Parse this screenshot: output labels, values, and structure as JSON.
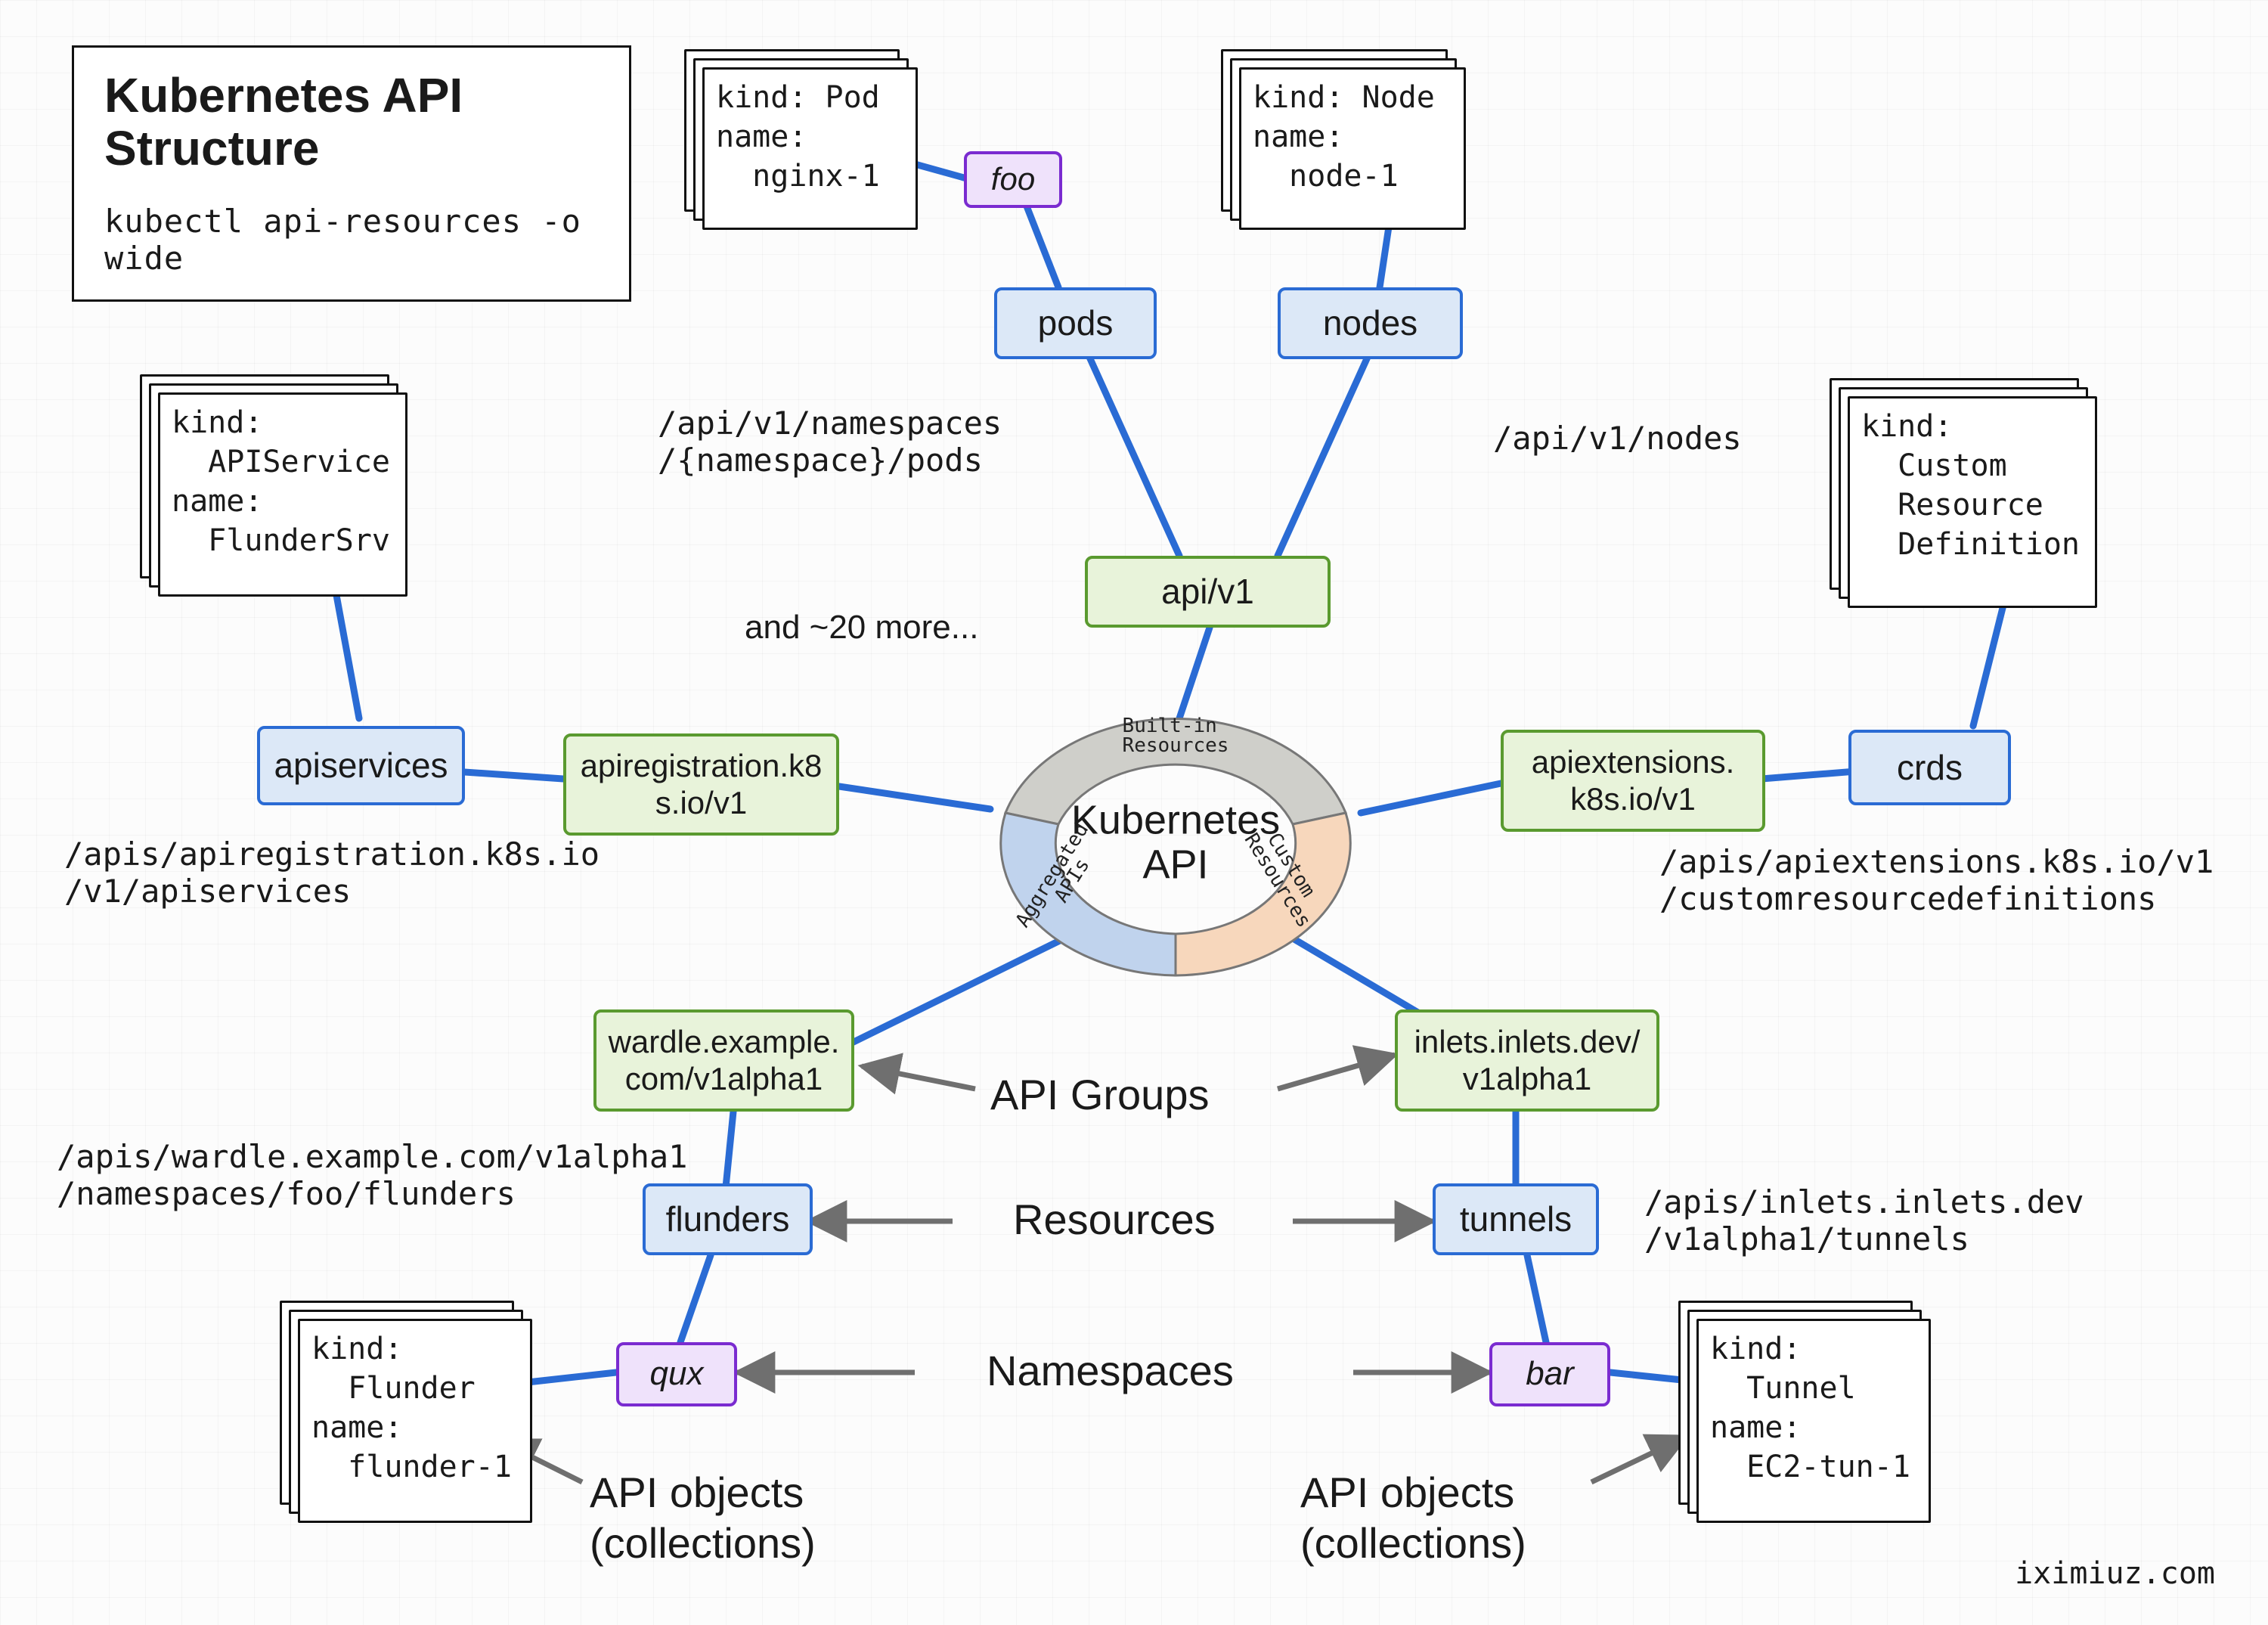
{
  "title": {
    "heading": "Kubernetes API\nStructure",
    "command": "kubectl api-resources -o wide"
  },
  "center": {
    "label": "Kubernetes\nAPI",
    "segments": {
      "builtin": "Built-in\nResources",
      "custom": "Custom\nResources",
      "aggregated": "Aggregated\nAPIs"
    }
  },
  "category_labels": {
    "api_groups": "API Groups",
    "resources": "Resources",
    "namespaces": "Namespaces",
    "api_objects_left": "API objects\n(collections)",
    "api_objects_right": "API objects\n(collections)"
  },
  "notes": {
    "and_more": "and ~20 more..."
  },
  "api_groups": {
    "apiregistration": "apiregistration.k8\ns.io/v1",
    "api_v1": "api/v1",
    "apiextensions": "apiextensions.\nk8s.io/v1",
    "wardle": "wardle.example.\ncom/v1alpha1",
    "inlets": "inlets.inlets.dev/\nv1alpha1"
  },
  "resources": {
    "apiservices": "apiservices",
    "pods": "pods",
    "nodes": "nodes",
    "crds": "crds",
    "flunders": "flunders",
    "tunnels": "tunnels"
  },
  "namespaces": {
    "foo": "foo",
    "qux": "qux",
    "bar": "bar"
  },
  "objects": {
    "apiservice": "kind:\n  APIService\nname:\n  FlunderSrv",
    "pod": "kind: Pod\nname:\n  nginx-1",
    "node": "kind: Node\nname:\n  node-1",
    "crd": "kind:\n  Custom\n  Resource\n  Definition",
    "flunder": "kind:\n  Flunder\nname:\n  flunder-1",
    "tunnel": "kind:\n  Tunnel\nname:\n  EC2-tun-1"
  },
  "paths": {
    "apiservices": "/apis/apiregistration.k8s.io\n/v1/apiservices",
    "pods": "/api/v1/namespaces\n/{namespace}/pods",
    "nodes": "/api/v1/nodes",
    "crds": "/apis/apiextensions.k8s.io/v1\n/customresourcedefinitions",
    "flunders": "/apis/wardle.example.com/v1alpha1\n/namespaces/foo/flunders",
    "tunnels": "/apis/inlets.inlets.dev\n/v1alpha1/tunnels"
  },
  "credit": "iximiuz.com",
  "colors": {
    "green_border": "#5a9a2f",
    "blue_border": "#2a6bd4",
    "purple_border": "#7a2bd0",
    "gray_arrow": "#6f6f6f",
    "blue_line": "#2a6bd4",
    "donut_gray": "#cfcfca",
    "donut_peach": "#f7d7bc",
    "donut_blue": "#c0d3ed"
  }
}
